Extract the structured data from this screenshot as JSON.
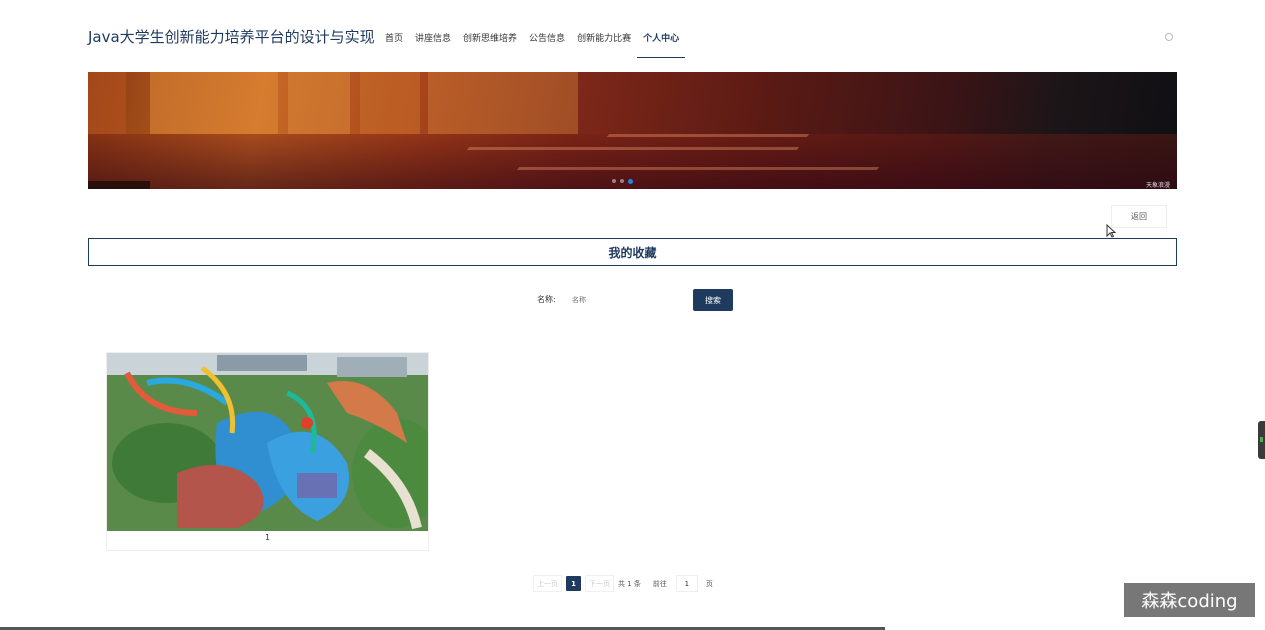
{
  "header": {
    "site_title": "Java大学生创新能力培养平台的设计与实现",
    "nav": [
      {
        "label": "首页"
      },
      {
        "label": "讲座信息"
      },
      {
        "label": "创新思维培养"
      },
      {
        "label": "公告信息"
      },
      {
        "label": "创新能力比赛"
      },
      {
        "label": "个人中心",
        "active": true
      }
    ]
  },
  "banner": {
    "slides_total": 3,
    "active_slide": 3,
    "caption": "天象浪漫"
  },
  "back_button": "返回",
  "section_title": "我的收藏",
  "search": {
    "label": "名称:",
    "placeholder": "名称",
    "button": "搜索"
  },
  "favorites": [
    {
      "title": "1",
      "image": "water-park-aerial-photo"
    }
  ],
  "pagination": {
    "prev": "上一页",
    "current": "1",
    "next": "下一页",
    "total": "共 1 条",
    "goto_label": "前往",
    "goto_value": "1",
    "page_suffix": "页"
  },
  "watermark": "森森coding",
  "colors": {
    "primary": "#1e3a5f",
    "dot_active": "#1e88e5"
  }
}
